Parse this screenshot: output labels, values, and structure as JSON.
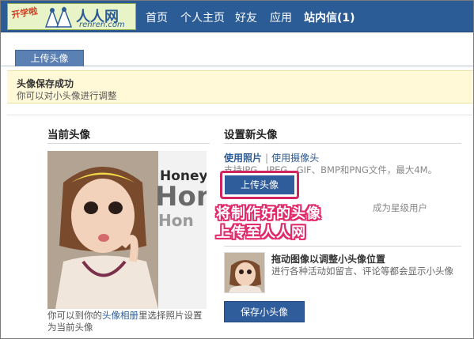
{
  "header": {
    "logo": {
      "badge_text": "开学啦",
      "name": "人人网",
      "domain": "renren.com"
    },
    "nav": [
      {
        "label": "首页"
      },
      {
        "label": "个人主页"
      },
      {
        "label": "好友"
      },
      {
        "label": "应用"
      },
      {
        "label": "站内信(1)"
      }
    ]
  },
  "tabs": [
    {
      "label": "上传头像"
    }
  ],
  "banner": {
    "title": "头像保存成功",
    "subtitle": "你可以对小头像进行调整"
  },
  "current_avatar": {
    "title": "当前头像",
    "photo_words": [
      "Honey",
      "Hon",
      "Hon"
    ],
    "note_prefix": "你可以到你的",
    "note_link": "头像相册",
    "note_suffix": "里选择照片设置为当前头像"
  },
  "new_avatar": {
    "title": "设置新头像",
    "use_photo_link": "使用照片",
    "separator": "|",
    "use_camera_link": "使用摄像头",
    "format_note": "支持JPG、JPEG、GIF、BMP和PNG文件，最大4M。",
    "upload_button": "上传头像",
    "vip_note": "成为星级用户",
    "annotation_line1": "将制作好的头像",
    "annotation_line2": "上传至人人网"
  },
  "small_avatar": {
    "title": "拖动图像以调整小头像位置",
    "subtitle": "进行各种活动如留言、评论等都会显示小头像",
    "save_button": "保存小头像"
  },
  "colors": {
    "nav_bg": "#2b5c96",
    "accent": "#2f5d9c",
    "highlight": "#e02a6b",
    "banner_bg": "#fff9d8"
  }
}
